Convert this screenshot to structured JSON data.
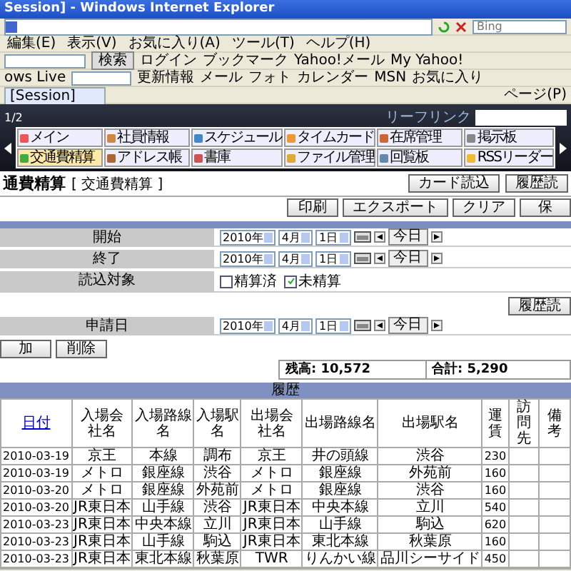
{
  "window": {
    "title": "Session] - Windows Internet Explorer"
  },
  "address_bar": {
    "search_placeholder": "Bing"
  },
  "menu": [
    "編集(E)",
    "表示(V)",
    "お気に入り(A)",
    "ツール(T)",
    "ヘルプ(H)"
  ],
  "toolbar": {
    "search_button": "検索",
    "items": [
      "ログイン",
      "ブックマーク",
      "Yahoo!メール",
      "My Yahoo!"
    ]
  },
  "links_bar": {
    "label": "ows Live",
    "items": [
      "更新情報",
      "メール",
      "フォト",
      "カレンダー",
      "MSN",
      "お気に入り"
    ]
  },
  "tabs": [
    {
      "label": "[Session]",
      "selected": true
    }
  ],
  "command_bar": [
    "ページ(P)"
  ],
  "app_header": {
    "link_label": "リーフリンク",
    "page": "1/2",
    "nav": [
      {
        "label": "メイン",
        "selected": false
      },
      {
        "label": "社員情報",
        "selected": false
      },
      {
        "label": "スケジュール",
        "selected": false
      },
      {
        "label": "タイムカード",
        "selected": false
      },
      {
        "label": "在席管理",
        "selected": false
      },
      {
        "label": "掲示板",
        "selected": false
      },
      {
        "label": "交通費精算",
        "selected": true
      },
      {
        "label": "アドレス帳",
        "selected": false
      },
      {
        "label": "書庫",
        "selected": false
      },
      {
        "label": "ファイル管理",
        "selected": false
      },
      {
        "label": "回覧板",
        "selected": false
      },
      {
        "label": "RSSリーダー",
        "selected": false
      }
    ]
  },
  "page_title": "通費精算",
  "page_subtitle": "[ 交通費精算 ]",
  "top_buttons": [
    "カード読込",
    "履歴読"
  ],
  "action_buttons": [
    "印刷",
    "エクスポート",
    "クリア",
    "保"
  ],
  "filter_rows": [
    {
      "label": "開始",
      "kind": "date",
      "year": "2010年",
      "month": "4月",
      "day": "1日",
      "today": "今日"
    },
    {
      "label": "終了",
      "kind": "date",
      "year": "2010年",
      "month": "4月",
      "day": "1日",
      "today": "今日"
    },
    {
      "label": "読込対象",
      "kind": "checks",
      "options": [
        {
          "label": "精算済",
          "checked": false
        },
        {
          "label": "未精算",
          "checked": true
        }
      ]
    }
  ],
  "load_button": "履歴読",
  "apply_rows": [
    {
      "label": "申請日",
      "kind": "date",
      "year": "2010年",
      "month": "4月",
      "day": "1日",
      "today": "今日"
    }
  ],
  "list_buttons": [
    "加",
    "削除"
  ],
  "summary": {
    "balance": "残高: 10,572",
    "total": "合計: 5,290"
  },
  "history": {
    "title": "履歴",
    "columns": [
      "日付",
      "入場会社名",
      "入場路線名",
      "入場駅名",
      "出場会社名",
      "出場路線名",
      "出場駅名",
      "運賃",
      "訪問先",
      "備考"
    ],
    "rows": [
      [
        "2010-03-19",
        "京王",
        "本線",
        "調布",
        "京王",
        "井の頭線",
        "渋谷",
        "230"
      ],
      [
        "2010-03-19",
        "メトロ",
        "銀座線",
        "渋谷",
        "メトロ",
        "銀座線",
        "外苑前",
        "160"
      ],
      [
        "2010-03-20",
        "メトロ",
        "銀座線",
        "外苑前",
        "メトロ",
        "銀座線",
        "渋谷",
        "160"
      ],
      [
        "2010-03-20",
        "JR東日本",
        "山手線",
        "渋谷",
        "JR東日本",
        "中央本線",
        "立川",
        "540"
      ],
      [
        "2010-03-23",
        "JR東日本",
        "中央本線",
        "立川",
        "JR東日本",
        "山手線",
        "駒込",
        "620"
      ],
      [
        "2010-03-23",
        "JR東日本",
        "山手線",
        "駒込",
        "JR東日本",
        "東北本線",
        "秋葉原",
        "160"
      ],
      [
        "2010-03-23",
        "JR東日本",
        "東北本線",
        "秋葉原",
        "TWR",
        "りんかい線",
        "品川シーサイド",
        "450"
      ]
    ]
  }
}
